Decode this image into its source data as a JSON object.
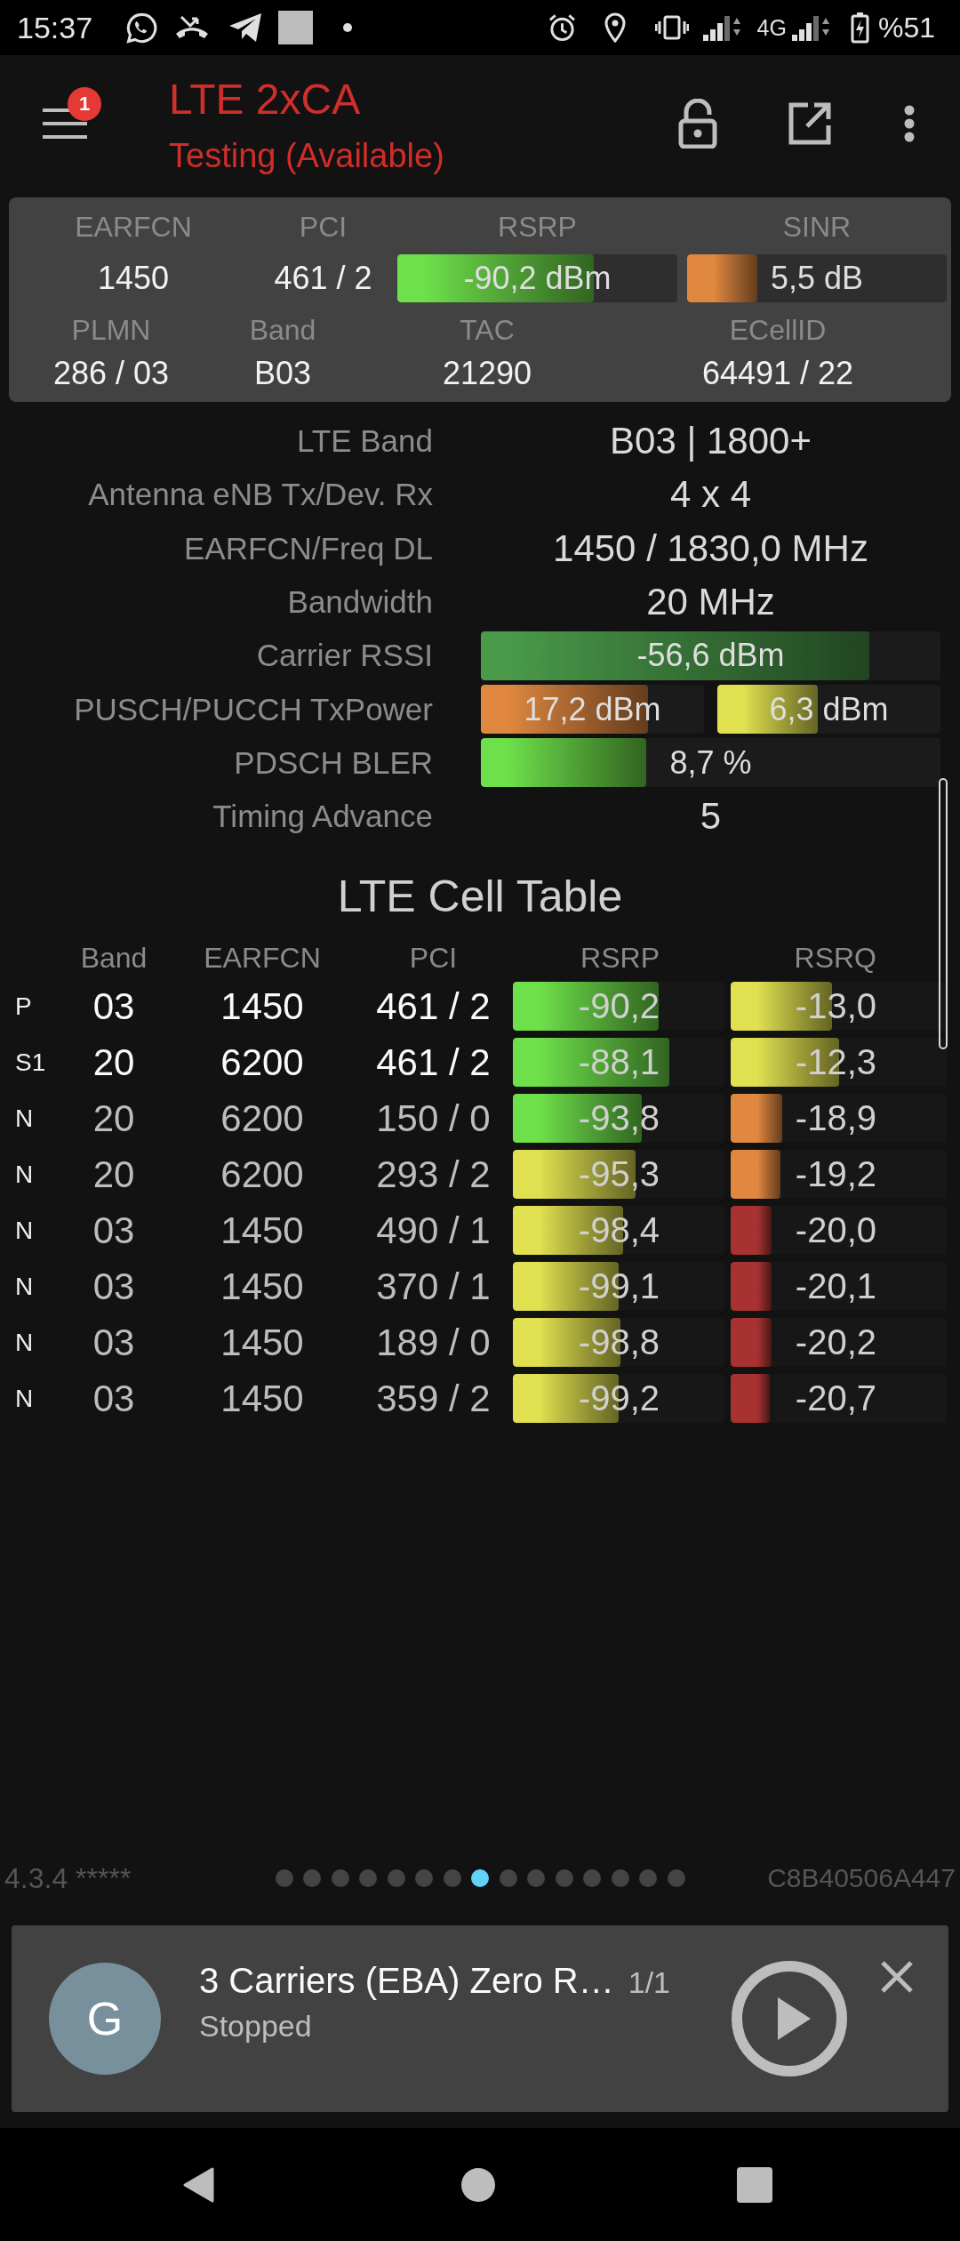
{
  "status_bar": {
    "time": "15:37",
    "network_type": "4G",
    "battery": "%51"
  },
  "header": {
    "menu_badge": "1",
    "title": "LTE 2xCA",
    "subtitle": "Testing (Available)"
  },
  "summary": {
    "rows": [
      {
        "cells": [
          {
            "kind": "text",
            "label": "EARFCN",
            "value": "1450"
          },
          {
            "kind": "text",
            "label": "PCI",
            "value": "461 / 2"
          },
          {
            "kind": "bar",
            "label": "RSRP",
            "value": "-90,2 dBm",
            "level": 0.7,
            "color": "#6ee04a"
          },
          {
            "kind": "bar",
            "label": "SINR",
            "value": "5,5 dB",
            "level": 0.27,
            "color": "#e08840"
          }
        ]
      },
      {
        "cells": [
          {
            "kind": "text",
            "label": "PLMN",
            "value": "286 / 03"
          },
          {
            "kind": "text",
            "label": "Band",
            "value": "B03"
          },
          {
            "kind": "text",
            "label": "TAC",
            "value": "21290"
          },
          {
            "kind": "text",
            "label": "ECellID",
            "value": "64491 / 22"
          }
        ]
      }
    ]
  },
  "details": [
    {
      "kind": "text",
      "label": "LTE Band",
      "value": "B03 | 1800+"
    },
    {
      "kind": "text",
      "label": "Antenna eNB Tx/Dev. Rx",
      "value": "4 x 4"
    },
    {
      "kind": "text",
      "label": "EARFCN/Freq DL",
      "value": "1450 / 1830,0 MHz"
    },
    {
      "kind": "text",
      "label": "Bandwidth",
      "value": "20 MHz"
    },
    {
      "kind": "bars",
      "label": "Carrier RSSI",
      "bars": [
        {
          "value": "-56,6 dBm",
          "level": 0.845,
          "color": "#4a9a4a"
        }
      ]
    },
    {
      "kind": "bars",
      "label": "PUSCH/PUCCH TxPower",
      "bars": [
        {
          "value": "17,2 dBm",
          "level": 0.75,
          "color": "#e08840"
        },
        {
          "value": "6,3 dBm",
          "level": 0.45,
          "color": "#e0e050"
        }
      ]
    },
    {
      "kind": "bars",
      "label": "PDSCH BLER",
      "bars": [
        {
          "value": "8,7 %",
          "level": 0.36,
          "color": "#6ee04a"
        }
      ]
    },
    {
      "kind": "text",
      "label": "Timing Advance",
      "value": "5"
    }
  ],
  "cell_table": {
    "title": "LTE Cell Table",
    "columns": [
      "Band",
      "EARFCN",
      "PCI",
      "RSRP",
      "RSRQ"
    ],
    "rows": [
      {
        "type": "P",
        "serving": true,
        "band": "03",
        "earfcn": "1450",
        "pci": "461 / 2",
        "rsrp": {
          "value": "-90,2",
          "level": 0.69,
          "color": "#6ee04a"
        },
        "rsrq": {
          "value": "-13,0",
          "level": 0.47,
          "color": "#e0e050"
        }
      },
      {
        "type": "S1",
        "serving": true,
        "band": "20",
        "earfcn": "6200",
        "pci": "461 / 2",
        "rsrp": {
          "value": "-88,1",
          "level": 0.74,
          "color": "#6ee04a"
        },
        "rsrq": {
          "value": "-12,3",
          "level": 0.5,
          "color": "#e0e050"
        }
      },
      {
        "type": "N",
        "serving": false,
        "band": "20",
        "earfcn": "6200",
        "pci": "150 / 0",
        "rsrp": {
          "value": "-93,8",
          "level": 0.61,
          "color": "#6ee04a"
        },
        "rsrq": {
          "value": "-18,9",
          "level": 0.24,
          "color": "#e08840"
        }
      },
      {
        "type": "N",
        "serving": false,
        "band": "20",
        "earfcn": "6200",
        "pci": "293 / 2",
        "rsrp": {
          "value": "-95,3",
          "level": 0.58,
          "color": "#e0e050"
        },
        "rsrq": {
          "value": "-19,2",
          "level": 0.23,
          "color": "#e08840"
        }
      },
      {
        "type": "N",
        "serving": false,
        "band": "03",
        "earfcn": "1450",
        "pci": "490 / 1",
        "rsrp": {
          "value": "-98,4",
          "level": 0.52,
          "color": "#e0e050"
        },
        "rsrq": {
          "value": "-20,0",
          "level": 0.19,
          "color": "#a83232"
        }
      },
      {
        "type": "N",
        "serving": false,
        "band": "03",
        "earfcn": "1450",
        "pci": "370 / 1",
        "rsrp": {
          "value": "-99,1",
          "level": 0.5,
          "color": "#e0e050"
        },
        "rsrq": {
          "value": "-20,1",
          "level": 0.19,
          "color": "#a83232"
        }
      },
      {
        "type": "N",
        "serving": false,
        "band": "03",
        "earfcn": "1450",
        "pci": "189 / 0",
        "rsrp": {
          "value": "-98,8",
          "level": 0.51,
          "color": "#e0e050"
        },
        "rsrq": {
          "value": "-20,2",
          "level": 0.19,
          "color": "#a83232"
        }
      },
      {
        "type": "N",
        "serving": false,
        "band": "03",
        "earfcn": "1450",
        "pci": "359 / 2",
        "rsrp": {
          "value": "-99,2",
          "level": 0.5,
          "color": "#e0e050"
        },
        "rsrq": {
          "value": "-20,7",
          "level": 0.18,
          "color": "#a83232"
        }
      }
    ]
  },
  "footer": {
    "version": "4.3.4 *****",
    "device_id": "C8B40506A447",
    "pages": [
      {
        "selected": false
      },
      {
        "selected": false
      },
      {
        "selected": false
      },
      {
        "selected": false
      },
      {
        "selected": false
      },
      {
        "selected": false
      },
      {
        "selected": false
      },
      {
        "selected": true
      },
      {
        "selected": false
      },
      {
        "selected": false
      },
      {
        "selected": false
      },
      {
        "selected": false
      },
      {
        "selected": false
      },
      {
        "selected": false
      },
      {
        "selected": false
      }
    ]
  },
  "notification": {
    "avatar_letter": "G",
    "title": "3 Carriers (EBA) Zero R…",
    "counter": "1/1",
    "status": "Stopped"
  }
}
